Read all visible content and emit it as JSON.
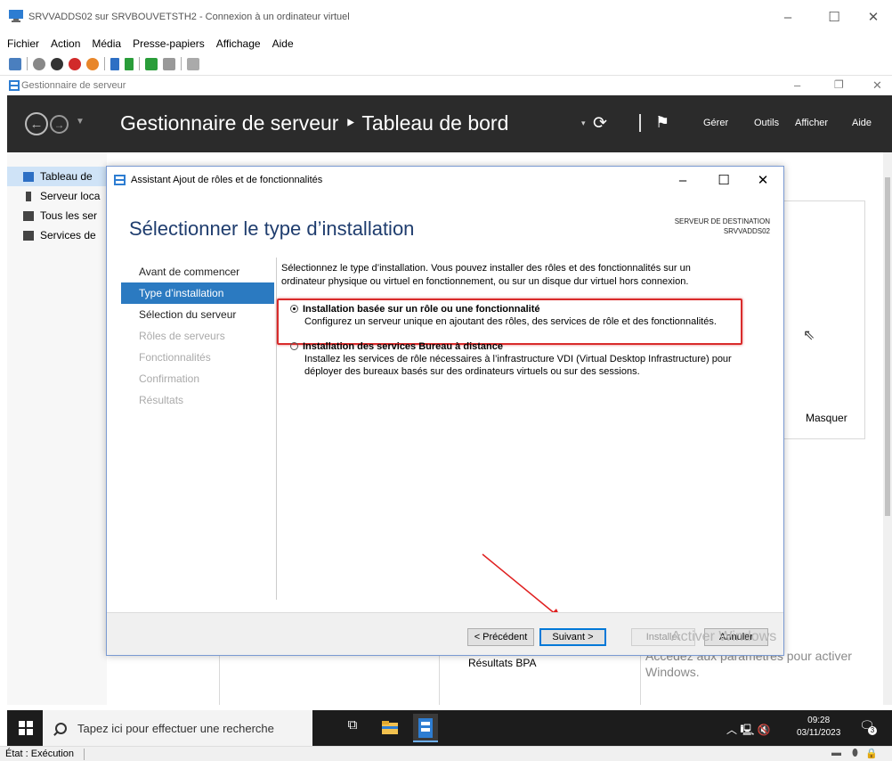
{
  "vm_window": {
    "title": "SRVVADDS02 sur SRVBOUVETSTH2 - Connexion à un ordinateur virtuel",
    "menu": [
      "Fichier",
      "Action",
      "Média",
      "Presse-papiers",
      "Affichage",
      "Aide"
    ],
    "status": "État : Exécution"
  },
  "server_manager": {
    "window_title": "Gestionnaire de serveur",
    "breadcrumb": "Gestionnaire de serveur ‣ Tableau de bord",
    "menu": {
      "manage": "Gérer",
      "tools": "Outils",
      "view": "Afficher",
      "help": "Aide"
    },
    "nav": [
      "Tableau de",
      "Serveur loca",
      "Tous les ser",
      "Services de"
    ],
    "hide_label": "Masquer",
    "bpa_label": "Résultats BPA",
    "activate_windows": {
      "line1": "Activer Windows",
      "line2": "Accédez aux paramètres pour activer",
      "line3": "Windows."
    }
  },
  "dialog": {
    "title": "Assistant Ajout de rôles et de fonctionnalités",
    "heading": "Sélectionner le type d’installation",
    "destination_label": "SERVEUR DE DESTINATION",
    "destination_server": "SRVVADDS02",
    "steps": [
      {
        "label": "Avant de commencer",
        "state": "normal"
      },
      {
        "label": "Type d’installation",
        "state": "active"
      },
      {
        "label": "Sélection du serveur",
        "state": "normal"
      },
      {
        "label": "Rôles de serveurs",
        "state": "disabled"
      },
      {
        "label": "Fonctionnalités",
        "state": "disabled"
      },
      {
        "label": "Confirmation",
        "state": "disabled"
      },
      {
        "label": "Résultats",
        "state": "disabled"
      }
    ],
    "intro_line1": "Sélectionnez le type d’installation. Vous pouvez installer des rôles et des fonctionnalités sur un",
    "intro_line2": "ordinateur physique ou virtuel en fonctionnement, ou sur un disque dur virtuel hors connexion.",
    "options": [
      {
        "label": "Installation basée sur un rôle ou une fonctionnalité",
        "desc1": "Configurez un serveur unique en ajoutant des rôles, des services de rôle et des fonctionnalités.",
        "desc2": "",
        "selected": true
      },
      {
        "label": "Installation des services Bureau à distance",
        "desc1": "Installez les services de rôle nécessaires à l’infrastructure VDI (Virtual Desktop Infrastructure) pour",
        "desc2": "déployer des bureaux basés sur des ordinateurs virtuels ou sur des sessions.",
        "selected": false
      }
    ],
    "buttons": {
      "previous": "< Précédent",
      "next": "Suivant >",
      "install": "Installer",
      "cancel": "Annuler"
    }
  },
  "taskbar": {
    "search_placeholder": "Tapez ici pour effectuer une recherche",
    "time": "09:28",
    "date": "03/11/2023",
    "notifications": "3"
  },
  "colors": {
    "header_bg": "#2b2b2b",
    "active_step": "#2b7ac1",
    "highlight_box": "#d92b2b",
    "taskbar_bg": "#1c1c1c"
  }
}
